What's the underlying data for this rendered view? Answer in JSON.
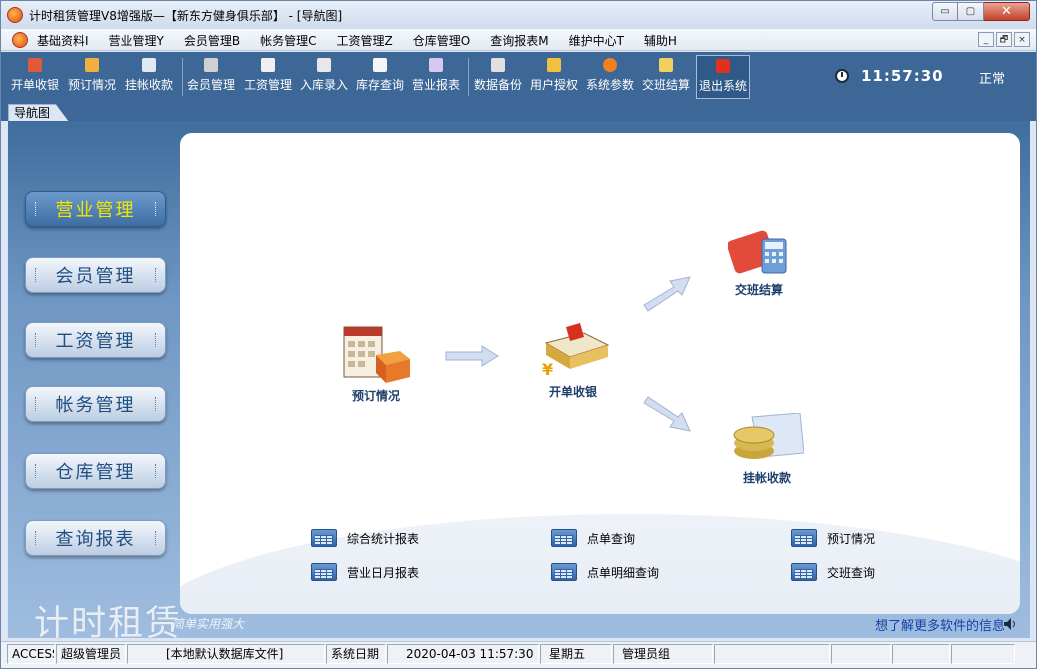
{
  "window": {
    "title": "计时租赁管理V8增强版—【新东方健身俱乐部】 - [导航图]",
    "buttons": {
      "minimize": "▭",
      "maximize": "▢",
      "close": "✕"
    }
  },
  "menu": {
    "items": [
      "基础资料I",
      "营业管理Y",
      "会员管理B",
      "帐务管理C",
      "工资管理Z",
      "仓库管理O",
      "查询报表M",
      "维护中心T",
      "辅助H"
    ],
    "mdi_buttons": [
      "_",
      "🗗",
      "×"
    ]
  },
  "toolbar": {
    "buttons": [
      {
        "label": "开单收银",
        "color": "#e05a3a"
      },
      {
        "label": "预订情况",
        "color": "#f0b040"
      },
      {
        "label": "挂帐收款",
        "color": "#e0e8f0"
      },
      {
        "label": "会员管理",
        "color": "#d0d0d0"
      },
      {
        "label": "工资管理",
        "color": "#f0f0f0"
      },
      {
        "label": "入库录入",
        "color": "#e8e8e8"
      },
      {
        "label": "库存查询",
        "color": "#f5f5f5"
      },
      {
        "label": "营业报表",
        "color": "#d8c8f0"
      },
      {
        "label": "数据备份",
        "color": "#e0e0e0"
      },
      {
        "label": "用户授权",
        "color": "#f0c040"
      },
      {
        "label": "系统参数",
        "color": "#f08020"
      },
      {
        "label": "交班结算",
        "color": "#f0d060"
      },
      {
        "label": "退出系统",
        "color": "#e03020"
      }
    ],
    "clock": "11:57:30",
    "status": "正常"
  },
  "tab": {
    "label": "导航图"
  },
  "nav": {
    "items": [
      "营业管理",
      "会员管理",
      "工资管理",
      "帐务管理",
      "仓库管理",
      "查询报表"
    ],
    "active_index": 0
  },
  "flow": {
    "booking": "预订情况",
    "checkout": "开单收银",
    "shift": "交班结算",
    "credit": "挂帐收款"
  },
  "links": [
    "综合统计报表",
    "点单查询",
    "预订情况",
    "营业日月报表",
    "点单明细查询",
    "交班查询"
  ],
  "branding": {
    "brand": "计时租赁",
    "slogan": "简单实用强大",
    "info_link": "想了解更多软件的信息"
  },
  "statusbar": {
    "cells": [
      "ACCESS",
      "超级管理员",
      "[本地默认数据库文件]",
      "系统日期",
      "2020-04-03  11:57:30",
      "星期五",
      "管理员组",
      "",
      "",
      "",
      ""
    ]
  }
}
